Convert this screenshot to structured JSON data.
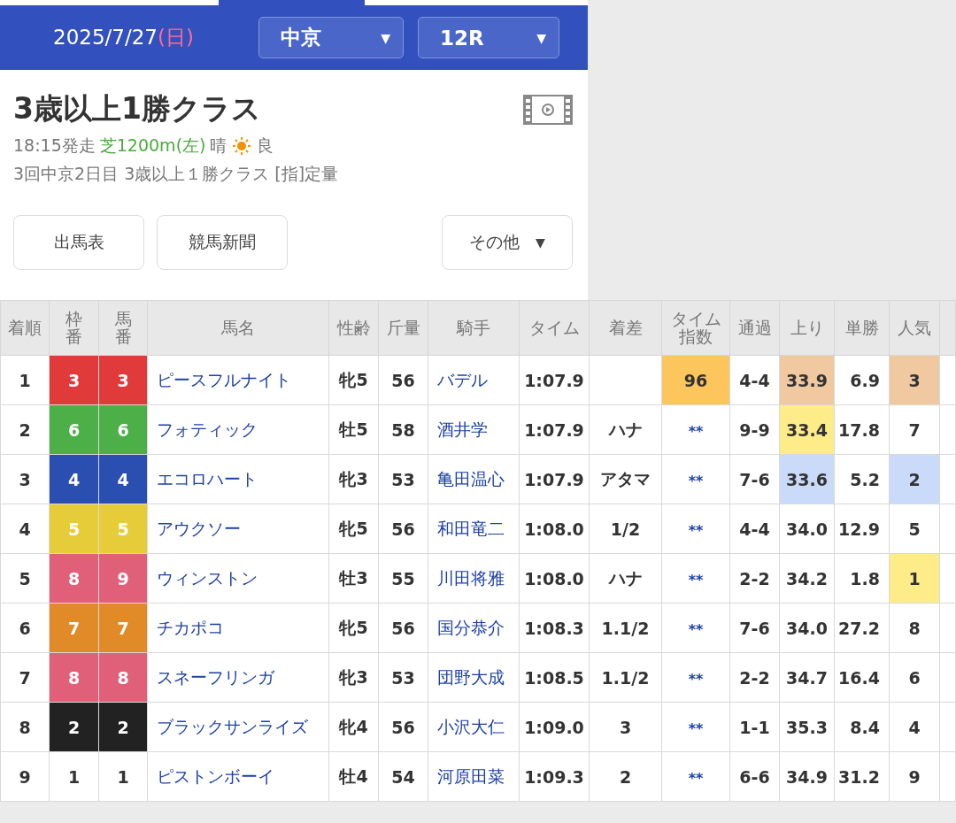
{
  "header": {
    "date": "2025/7/27",
    "weekday": "(日)",
    "venue_select": {
      "value": "中京",
      "caret": "▼"
    },
    "race_select": {
      "value": "12R",
      "caret": "▼"
    }
  },
  "race": {
    "title": "3歳以上1勝クラス",
    "start_time": "18:15発走",
    "course": "芝1200m(左)",
    "weather": "晴",
    "going": "良",
    "details": "3回中京2日目 3歳以上１勝クラス [指]定量"
  },
  "buttons": [
    {
      "label": "出馬表",
      "kind": "plain"
    },
    {
      "label": "競馬新聞",
      "kind": "plain"
    },
    {
      "label": "その他",
      "kind": "dropdown",
      "caret": "▼"
    }
  ],
  "table": {
    "columns": [
      {
        "label": "着順",
        "kind": "text"
      },
      {
        "label": "枠番",
        "kind": "frame"
      },
      {
        "label": "馬番",
        "kind": "frame"
      },
      {
        "label": "馬名",
        "kind": "link"
      },
      {
        "label": "性齢",
        "kind": "text"
      },
      {
        "label": "斤量",
        "kind": "text"
      },
      {
        "label": "騎手",
        "kind": "link"
      },
      {
        "label": "タイム",
        "kind": "text"
      },
      {
        "label": "着差",
        "kind": "text"
      },
      {
        "label": "タイム指数",
        "kind": "index"
      },
      {
        "label": "通過",
        "kind": "text"
      },
      {
        "label": "上り",
        "kind": "text"
      },
      {
        "label": "単勝",
        "kind": "odds"
      },
      {
        "label": "人気",
        "kind": "text"
      }
    ],
    "rows": [
      {
        "cells": [
          {
            "text": "1"
          },
          {
            "text": "3",
            "color": "#e03a3a"
          },
          {
            "text": "3",
            "color": "#e03a3a"
          },
          {
            "text": "ピースフルナイト"
          },
          {
            "text": "牝5"
          },
          {
            "text": "56"
          },
          {
            "text": "バデル"
          },
          {
            "text": "1:07.9"
          },
          {},
          {
            "text": "96",
            "color": "#fcc65c"
          },
          {
            "text": "4-4"
          },
          {
            "text": "33.9",
            "color": "#f1c9a1"
          },
          {
            "text": "6.9"
          },
          {
            "text": "3",
            "color": "#f1c9a1"
          }
        ]
      },
      {
        "cells": [
          {
            "text": "2"
          },
          {
            "text": "6",
            "color": "#4caf48"
          },
          {
            "text": "6",
            "color": "#4caf48"
          },
          {
            "text": "フォティック"
          },
          {
            "text": "牡5"
          },
          {
            "text": "58"
          },
          {
            "text": "酒井学"
          },
          {
            "text": "1:07.9"
          },
          {
            "text": "ハナ"
          },
          {
            "text": "**"
          },
          {
            "text": "9-9"
          },
          {
            "text": "33.4",
            "color": "#fdec88"
          },
          {
            "text": "17.8"
          },
          {
            "text": "7"
          }
        ]
      },
      {
        "cells": [
          {
            "text": "3"
          },
          {
            "text": "4",
            "color": "#2a4fb0"
          },
          {
            "text": "4",
            "color": "#2a4fb0"
          },
          {
            "text": "エコロハート"
          },
          {
            "text": "牝3"
          },
          {
            "text": "53"
          },
          {
            "text": "亀田温心"
          },
          {
            "text": "1:07.9"
          },
          {
            "text": "アタマ"
          },
          {
            "text": "**"
          },
          {
            "text": "7-6"
          },
          {
            "text": "33.6",
            "color": "#c9dbf9"
          },
          {
            "text": "5.2"
          },
          {
            "text": "2",
            "color": "#c9dbf9"
          }
        ]
      },
      {
        "cells": [
          {
            "text": "4"
          },
          {
            "text": "5",
            "color": "#e5cc38"
          },
          {
            "text": "5",
            "color": "#e5cc38"
          },
          {
            "text": "アウクソー"
          },
          {
            "text": "牝5"
          },
          {
            "text": "56"
          },
          {
            "text": "和田竜二"
          },
          {
            "text": "1:08.0"
          },
          {
            "text": "1/2"
          },
          {
            "text": "**"
          },
          {
            "text": "4-4"
          },
          {
            "text": "34.0"
          },
          {
            "text": "12.9"
          },
          {
            "text": "5"
          }
        ]
      },
      {
        "cells": [
          {
            "text": "5"
          },
          {
            "text": "8",
            "color": "#e0607a"
          },
          {
            "text": "9",
            "color": "#e0607a"
          },
          {
            "text": "ウィンストン"
          },
          {
            "text": "牡3"
          },
          {
            "text": "55"
          },
          {
            "text": "川田将雅"
          },
          {
            "text": "1:08.0"
          },
          {
            "text": "ハナ"
          },
          {
            "text": "**"
          },
          {
            "text": "2-2"
          },
          {
            "text": "34.2"
          },
          {
            "text": "1.8"
          },
          {
            "text": "1",
            "color": "#fdec88"
          }
        ]
      },
      {
        "cells": [
          {
            "text": "6"
          },
          {
            "text": "7",
            "color": "#e08a28"
          },
          {
            "text": "7",
            "color": "#e08a28"
          },
          {
            "text": "チカポコ"
          },
          {
            "text": "牝5"
          },
          {
            "text": "56"
          },
          {
            "text": "国分恭介"
          },
          {
            "text": "1:08.3"
          },
          {
            "text": "1.1/2"
          },
          {
            "text": "**"
          },
          {
            "text": "7-6"
          },
          {
            "text": "34.0"
          },
          {
            "text": "27.2"
          },
          {
            "text": "8"
          }
        ]
      },
      {
        "cells": [
          {
            "text": "7"
          },
          {
            "text": "8",
            "color": "#e0607a"
          },
          {
            "text": "8",
            "color": "#e0607a"
          },
          {
            "text": "スネーフリンガ"
          },
          {
            "text": "牝3"
          },
          {
            "text": "53"
          },
          {
            "text": "団野大成"
          },
          {
            "text": "1:08.5"
          },
          {
            "text": "1.1/2"
          },
          {
            "text": "**"
          },
          {
            "text": "2-2"
          },
          {
            "text": "34.7"
          },
          {
            "text": "16.4"
          },
          {
            "text": "6"
          }
        ]
      },
      {
        "cells": [
          {
            "text": "8"
          },
          {
            "text": "2",
            "color": "#222222"
          },
          {
            "text": "2",
            "color": "#222222"
          },
          {
            "text": "ブラックサンライズ"
          },
          {
            "text": "牝4"
          },
          {
            "text": "56"
          },
          {
            "text": "小沢大仁"
          },
          {
            "text": "1:09.0"
          },
          {
            "text": "3"
          },
          {
            "text": "**"
          },
          {
            "text": "1-1"
          },
          {
            "text": "35.3"
          },
          {
            "text": "8.4"
          },
          {
            "text": "4"
          }
        ]
      },
      {
        "cells": [
          {
            "text": "9"
          },
          {
            "text": "1",
            "color": "#ffffff"
          },
          {
            "text": "1",
            "color": "#ffffff"
          },
          {
            "text": "ピストンボーイ"
          },
          {
            "text": "牡4"
          },
          {
            "text": "54"
          },
          {
            "text": "河原田菜"
          },
          {
            "text": "1:09.3"
          },
          {
            "text": "2"
          },
          {
            "text": "**"
          },
          {
            "text": "6-6"
          },
          {
            "text": "34.9"
          },
          {
            "text": "31.2"
          },
          {
            "text": "9"
          }
        ]
      }
    ]
  }
}
